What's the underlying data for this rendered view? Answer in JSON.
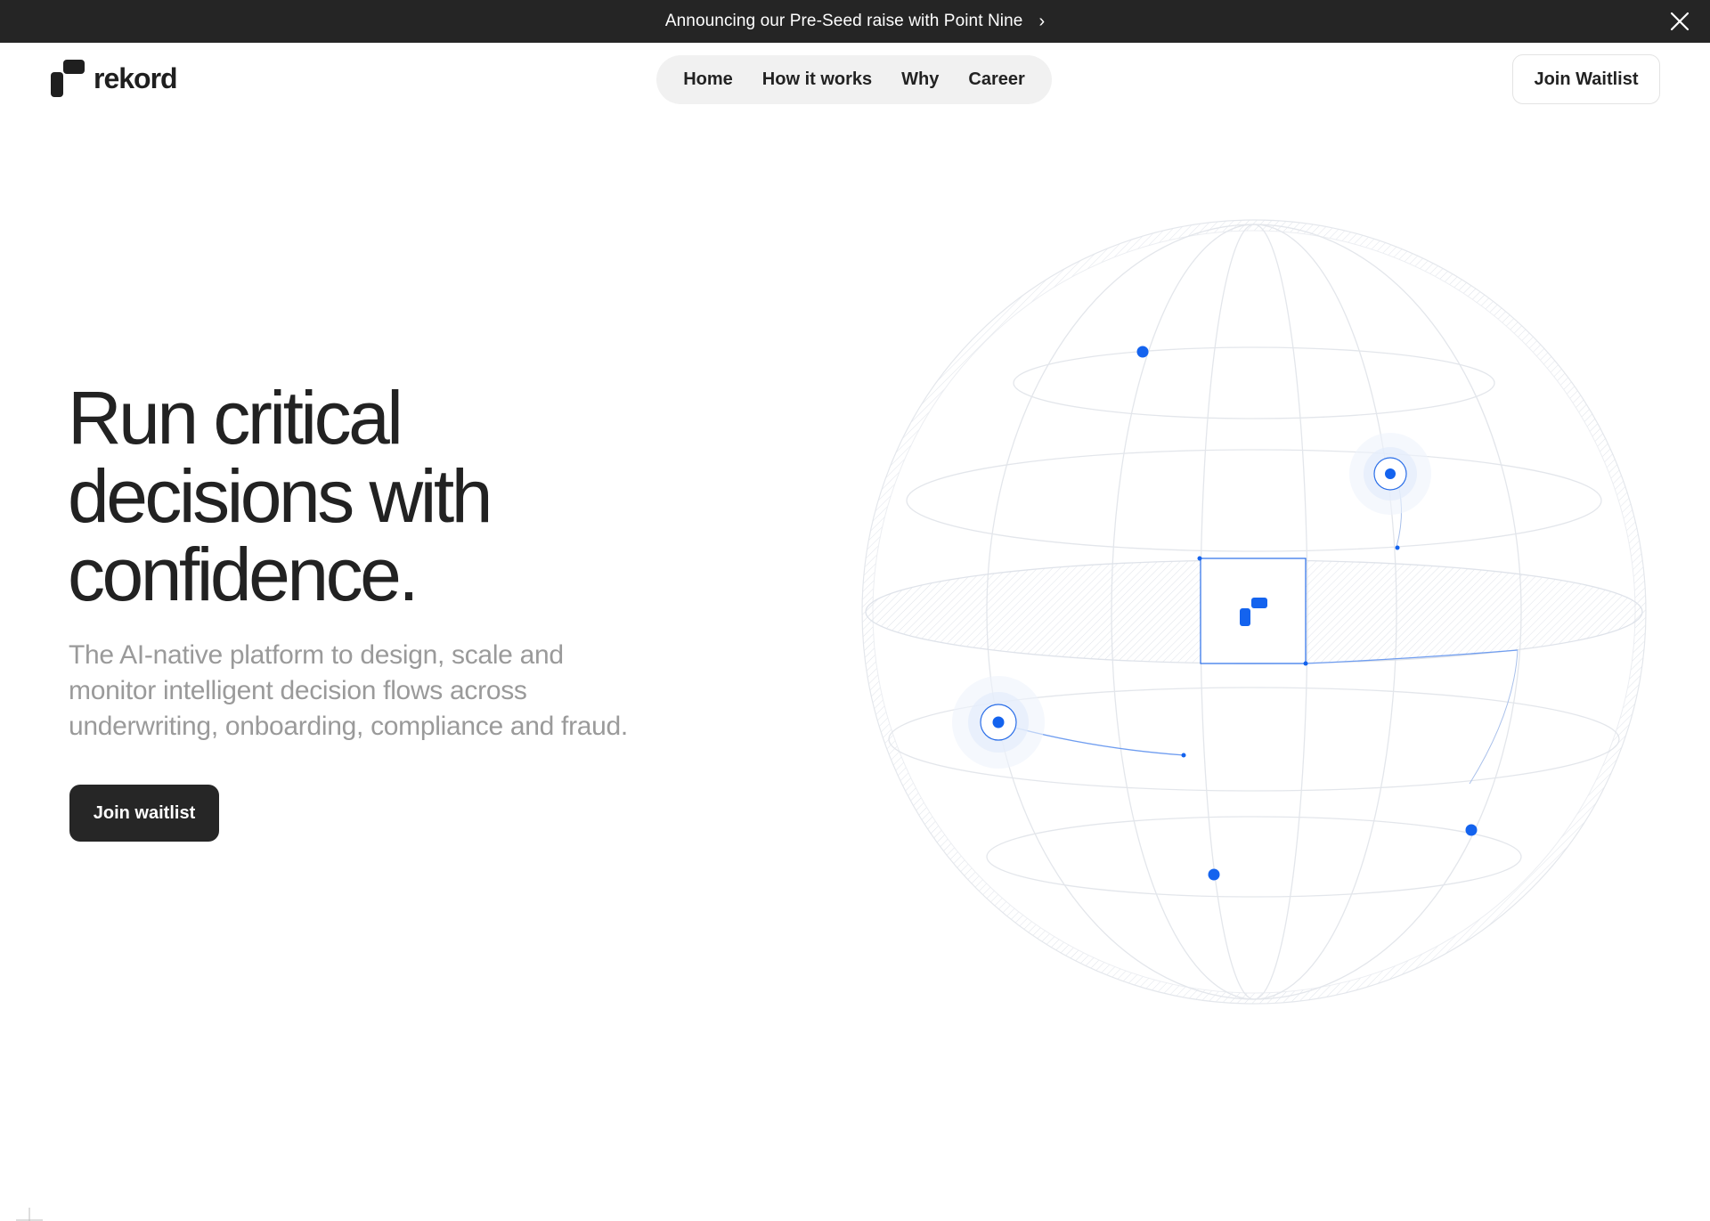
{
  "announcement": {
    "text": "Announcing our Pre-Seed raise with Point Nine",
    "chevron": "›",
    "close_icon": "close-icon"
  },
  "brand": {
    "name": "rekord",
    "logo_icon": "rekord-logo-icon"
  },
  "nav": {
    "items": [
      {
        "label": "Home"
      },
      {
        "label": "How it works"
      },
      {
        "label": "Why"
      },
      {
        "label": "Career"
      }
    ],
    "cta_label": "Join Waitlist"
  },
  "hero": {
    "title_lines": [
      "Run critical",
      "decisions with",
      "confidence."
    ],
    "subtitle_lines": [
      "The AI-native platform to design, scale and",
      "monitor intelligent decision flows across",
      "underwriting, onboarding, compliance and fraud."
    ],
    "cta_label": "Join waitlist"
  },
  "colors": {
    "accent": "#1463ee",
    "dark": "#252525",
    "muted_text": "#9a9a9a",
    "nav_bg": "#f1f1f1"
  }
}
